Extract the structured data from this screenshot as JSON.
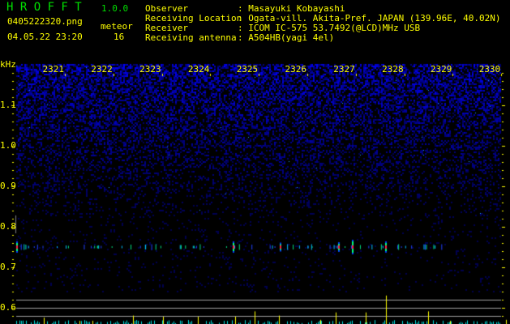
{
  "header": {
    "app_title": "H R O F F T",
    "version": "1.0.0",
    "filename": "0405222320.png",
    "datetime": "04.05.22 23:20",
    "meteor_label": "meteor",
    "meteor_count": "16"
  },
  "info": [
    {
      "label": "Observer",
      "value": ": Masayuki Kobayashi"
    },
    {
      "label": "Receiving Location",
      "value": ": Ogata-vill. Akita-Pref. JAPAN (139.96E, 40.02N)"
    },
    {
      "label": "Receiver",
      "value": ": ICOM IC-575 53.7492(@LCD)MHz USB"
    },
    {
      "label": "Receiving antenna",
      "value": ": A504HB(yagi 4el)"
    }
  ],
  "spectrogram": {
    "y_unit": "kHz",
    "y_ticks": [
      "1.1",
      "1.0",
      "0.9",
      "0.8",
      "0.7",
      "0.6"
    ],
    "y_range_khz": [
      0.56,
      1.2
    ],
    "x_ticks": [
      "2321",
      "2322",
      "2323",
      "2324",
      "2325",
      "2326",
      "2327",
      "2328",
      "2329",
      "2330"
    ],
    "echo_band_khz": 0.75,
    "colors": {
      "background": "#000000",
      "noise": "#1010c0",
      "axis": "#ffff00",
      "threshold": "#a0a0a0",
      "bar_low": "#00e0e0",
      "bar_high": "#ffff00"
    }
  }
}
